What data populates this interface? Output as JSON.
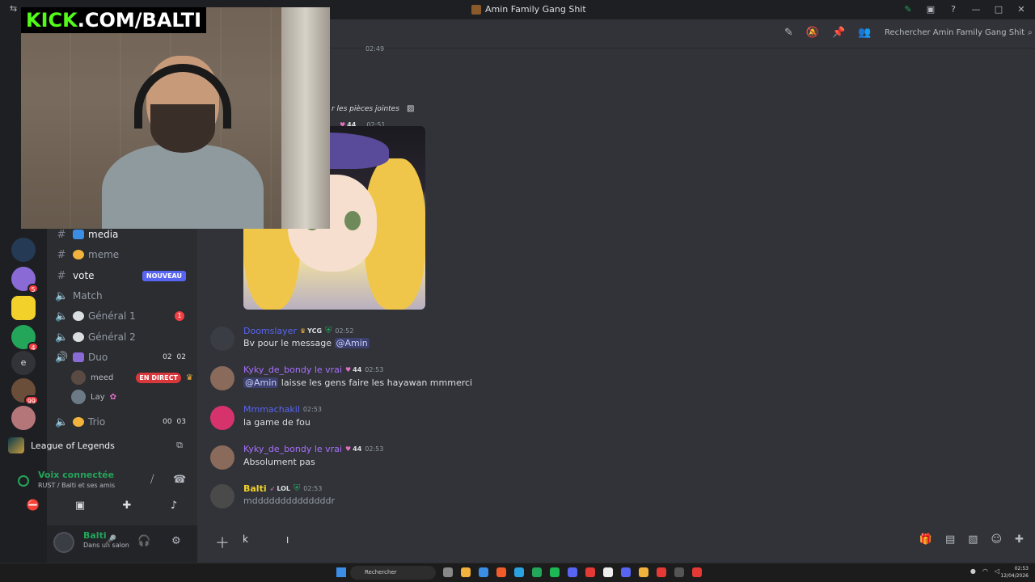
{
  "window": {
    "title": "Amin Family Gang Shit"
  },
  "header": {
    "search_placeholder": "Rechercher Amin Family Gang Shit"
  },
  "guild_badges": [
    "5",
    "4",
    "99",
    "e"
  ],
  "channels": {
    "media": "media",
    "meme": "meme",
    "vote": "vote",
    "vote_badge": "NOUVEAU",
    "match": "Match",
    "general1": "Général 1",
    "general1_badge": "1",
    "general2": "Général 2",
    "duo": "Duo",
    "duo_count_a": "02",
    "duo_count_b": "02",
    "duo_users": [
      {
        "name": "meed",
        "live": "EN DIRECT"
      },
      {
        "name": "Lay"
      }
    ],
    "trio": "Trio",
    "trio_count_a": "00",
    "trio_count_b": "03"
  },
  "activity": {
    "game": "League of Legends"
  },
  "voice": {
    "status": "Voix connectée",
    "location": "RUST / Balti et ses amis"
  },
  "user": {
    "name": "Balti",
    "status": "Dans un salon"
  },
  "webcam": {
    "overlay_kick": "KICK",
    "overlay_rest": ".COM/BALTI"
  },
  "messages": {
    "top_time": "02:49",
    "attachments_text": "r les pièces jointes",
    "image_msg": {
      "tag": "44",
      "time": "02:51"
    },
    "m1": {
      "author": "Doomslayer",
      "tag": "YCG",
      "time": "02:52",
      "text": "Bv pour le message ",
      "mention": "@Amin"
    },
    "m2": {
      "author": "Kyky_de_bondy le vrai",
      "tag": "44",
      "time": "02:53",
      "mention": "@Amin",
      "text": " laisse les gens faire les hayawan mmmerci"
    },
    "m3": {
      "author": "Mmmachakil",
      "time": "02:53",
      "text": "la game de fou"
    },
    "m4": {
      "author": "Kyky_de_bondy le vrai",
      "tag": "44",
      "time": "02:53",
      "text": "Absolument pas"
    },
    "m5": {
      "author": "Balti",
      "tag": "LOL",
      "time": "02:53",
      "text": "mddddddddddddddr"
    }
  },
  "composer": {
    "value": "k"
  },
  "taskbar": {
    "search": "Rechercher",
    "time": "02:53",
    "date": "12/04/2026"
  },
  "colors": {
    "accent": "#5865f2",
    "green": "#23a55a",
    "pink": "#a970ff"
  }
}
